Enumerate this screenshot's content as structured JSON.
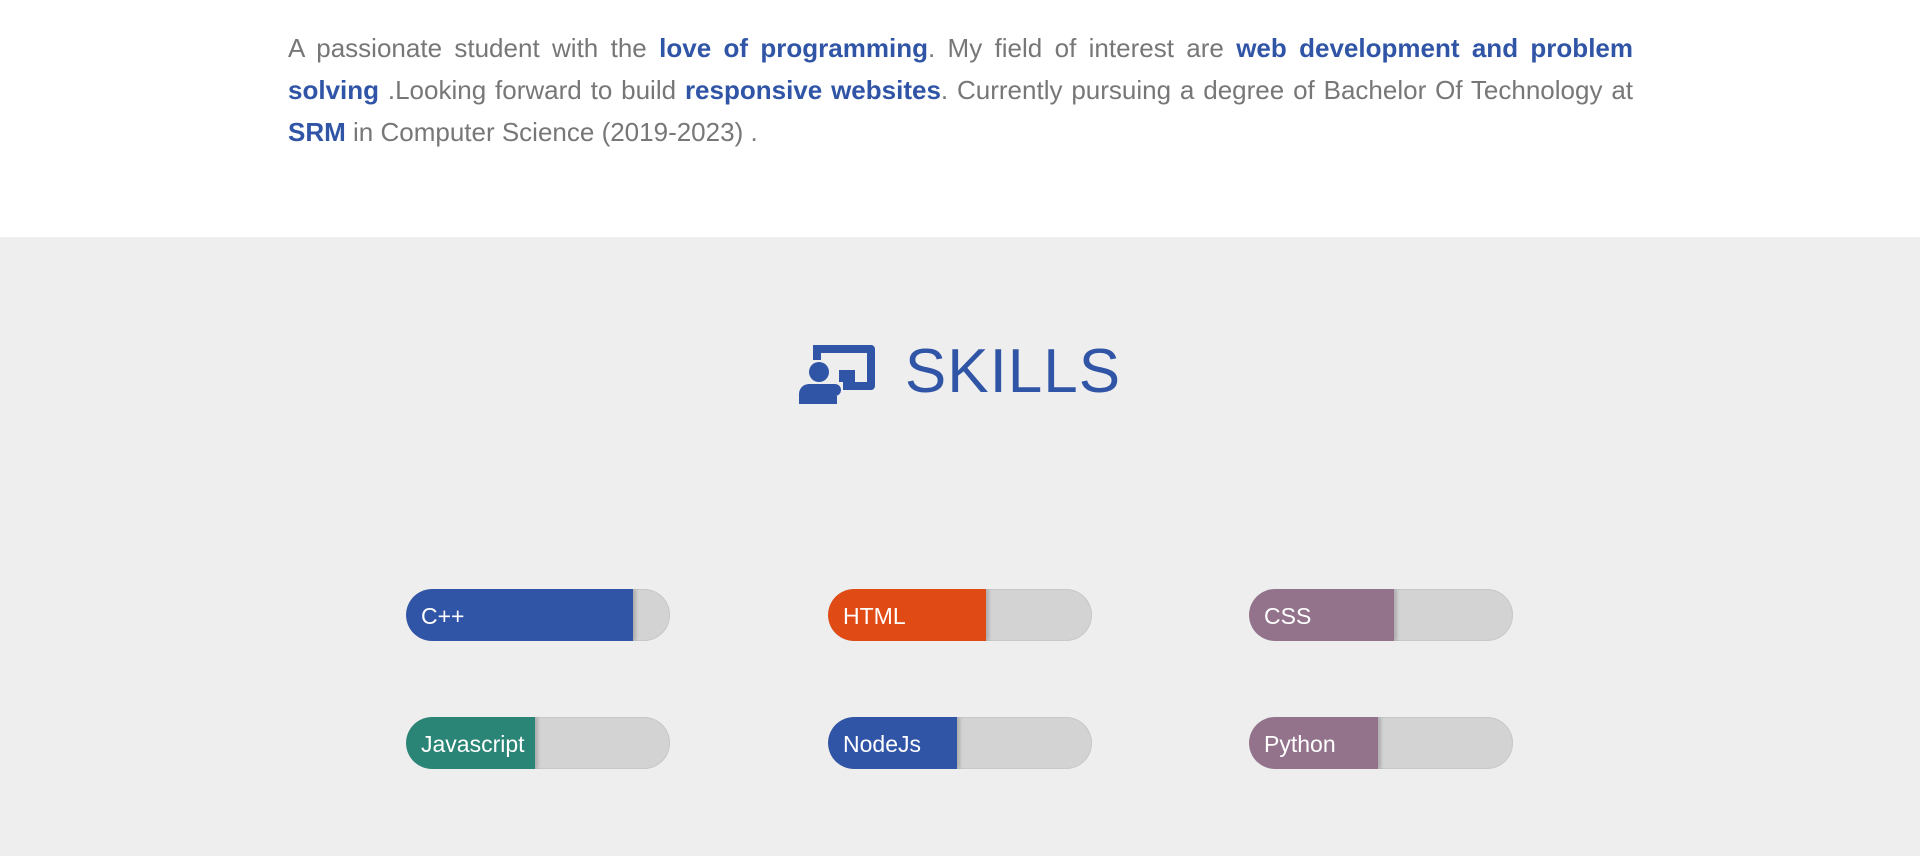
{
  "about": {
    "seg_1": "A passionate student with the ",
    "hl_1": "love of programming",
    "seg_2": ". My field of interest are ",
    "hl_2": "web development and problem solving",
    "seg_3": " .Looking forward to build ",
    "hl_3": "responsive websites",
    "seg_4": ". Currently pursuing a degree of Bachelor Of Technology at ",
    "hl_4": "SRM",
    "seg_5": " in Computer Science (2019-2023) ."
  },
  "skills": {
    "icon": "chalkboard-teacher-icon",
    "title": "SKILLS",
    "items": [
      {
        "label": "C++",
        "level": 0.86,
        "color": "#3155a6"
      },
      {
        "label": "HTML",
        "level": 0.6,
        "color": "#e04a14"
      },
      {
        "label": "CSS",
        "level": 0.55,
        "color": "#93738c"
      },
      {
        "label": "Javascript",
        "level": 0.49,
        "color": "#2b8576"
      },
      {
        "label": "NodeJs",
        "level": 0.49,
        "color": "#3155a6"
      },
      {
        "label": "Python",
        "level": 0.49,
        "color": "#93738c"
      }
    ]
  },
  "colors": {
    "accent": "#3155a6",
    "body_text": "#777777",
    "section_bg": "#eeeeee",
    "track": "#d3d3d3"
  }
}
